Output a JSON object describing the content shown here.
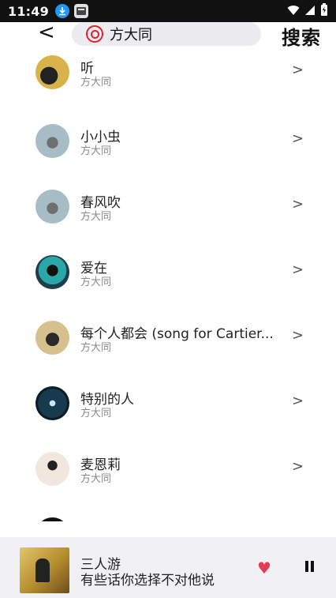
{
  "status_bar": {
    "time": "11:49"
  },
  "topbar": {
    "back_label": "<",
    "search_value": "方大同",
    "search_button_label": "搜索"
  },
  "songs": [
    {
      "title": "听",
      "artist": "方大同"
    },
    {
      "title": "小小虫",
      "artist": "方大同"
    },
    {
      "title": "春风吹",
      "artist": "方大同"
    },
    {
      "title": "爱在",
      "artist": "方大同"
    },
    {
      "title": "每个人都会 (song for Cartier...",
      "artist": "方大同"
    },
    {
      "title": "特别的人",
      "artist": "方大同"
    },
    {
      "title": "麦恩莉",
      "artist": "方大同"
    },
    {
      "title": "",
      "artist": ""
    }
  ],
  "chevron_glyph": ">",
  "player": {
    "title": "三人游",
    "subtitle": "有些话你选择不对他说",
    "favorite": true,
    "heart_glyph": "♥",
    "accent_color": "#e33b53"
  },
  "icons": {
    "status": [
      "download-icon",
      "app-notification-icon",
      "wifi-icon",
      "signal-icon",
      "battery-icon"
    ],
    "search": "netease-music-icon",
    "player": [
      "heart-icon",
      "pause-icon"
    ]
  }
}
